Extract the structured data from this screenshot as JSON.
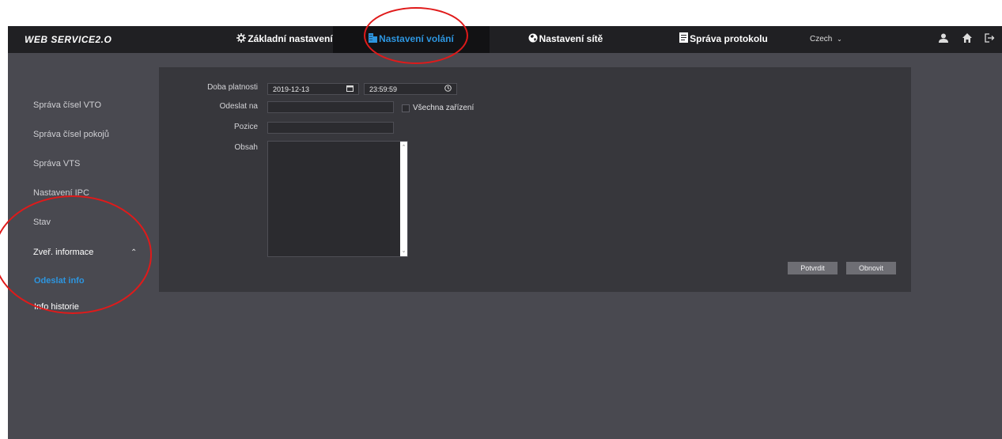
{
  "header": {
    "logo": "WEB SERVICE2.O",
    "nav": [
      {
        "label": "Základní nastavení",
        "icon": "gear-icon"
      },
      {
        "label": "Nastavení volání",
        "icon": "building-icon"
      },
      {
        "label": "Nastavení sítě",
        "icon": "globe-icon"
      },
      {
        "label": "Správa protokolu",
        "icon": "document-icon"
      }
    ],
    "language": "Czech",
    "icons": [
      "user-icon",
      "home-icon",
      "logout-icon"
    ]
  },
  "sidebar": {
    "items": [
      {
        "label": "Správa čísel VTO"
      },
      {
        "label": "Správa čísel pokojů"
      },
      {
        "label": "Správa VTS"
      },
      {
        "label": "Nastavení IPC"
      },
      {
        "label": "Stav"
      },
      {
        "label": "Zveř. informace"
      },
      {
        "label": "Odeslat info"
      },
      {
        "label": "Info historie"
      }
    ]
  },
  "form": {
    "validity_label": "Doba platnosti",
    "date_value": "2019-12-13",
    "time_value": "23:59:59",
    "send_to_label": "Odeslat na",
    "send_to_value": "",
    "all_devices_label": "Všechna zařízení",
    "all_devices_checked": false,
    "position_label": "Pozice",
    "position_value": "",
    "content_label": "Obsah",
    "content_value": "",
    "confirm_button": "Potvrdit",
    "refresh_button": "Obnovit"
  },
  "colors": {
    "accent": "#2d95df",
    "annotation": "#e01a1a"
  }
}
